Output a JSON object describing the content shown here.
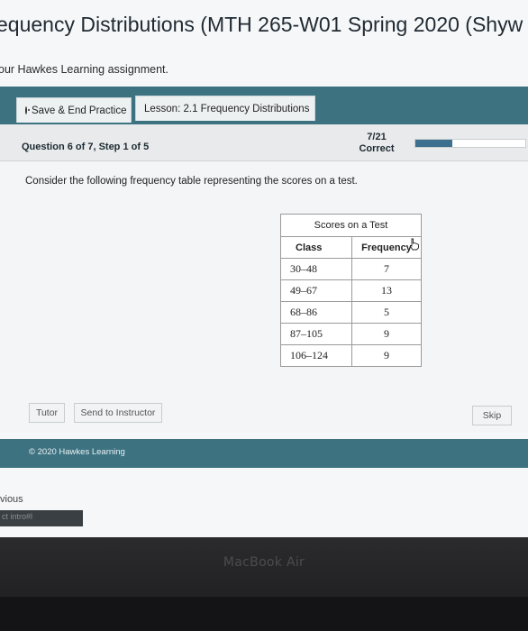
{
  "window": {
    "page_title": "equency Distributions (MTH 265-W01 Spring 2020 (Shyw",
    "subtitle": "our Hawkes Learning assignment."
  },
  "toolbar": {
    "save_label": "Save & End Practice",
    "lesson_label": "Lesson: 2.1 Frequency Distributions"
  },
  "question": {
    "label": "Question 6 of 7,  Step 1 of 5",
    "score_fraction": "7/21",
    "score_status": "Correct",
    "progress_fraction": 0.333,
    "prompt": "Consider the following frequency table representing the scores on a test."
  },
  "table": {
    "caption": "Scores on a Test",
    "headers": [
      "Class",
      "Frequency"
    ],
    "rows": [
      [
        "30–48",
        "7"
      ],
      [
        "49–67",
        "13"
      ],
      [
        "68–86",
        "5"
      ],
      [
        "87–105",
        "9"
      ],
      [
        "106–124",
        "9"
      ]
    ]
  },
  "actions": {
    "tutor": "Tutor",
    "send": "Send to Instructor",
    "skip": "Skip"
  },
  "footer": {
    "copyright": "© 2020 Hawkes Learning"
  },
  "background": {
    "previous_fragment": "vious",
    "strip_fragment": "ct intro#l"
  },
  "device": {
    "brand": "MacBook Air"
  },
  "colors": {
    "header_bar": "#3d7281",
    "progress_fill": "#3d6f8e"
  }
}
